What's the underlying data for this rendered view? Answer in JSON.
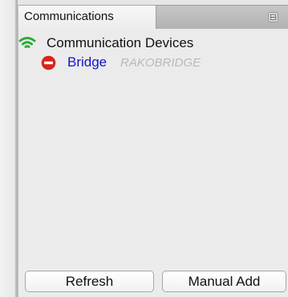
{
  "panel": {
    "tab_label": "Communications"
  },
  "tree": {
    "root": {
      "label": "Communication Devices",
      "icon": "wifi-icon"
    },
    "items": [
      {
        "label": "Bridge",
        "sublabel": "RAKOBRIDGE",
        "icon": "stop-icon"
      }
    ]
  },
  "buttons": {
    "refresh_label": "Refresh",
    "manual_add_label": "Manual Add"
  },
  "colors": {
    "wifi_green": "#2faa3a",
    "stop_red": "#d9241c",
    "link_blue": "#1212cc",
    "muted_gray": "#b9b9b9"
  }
}
